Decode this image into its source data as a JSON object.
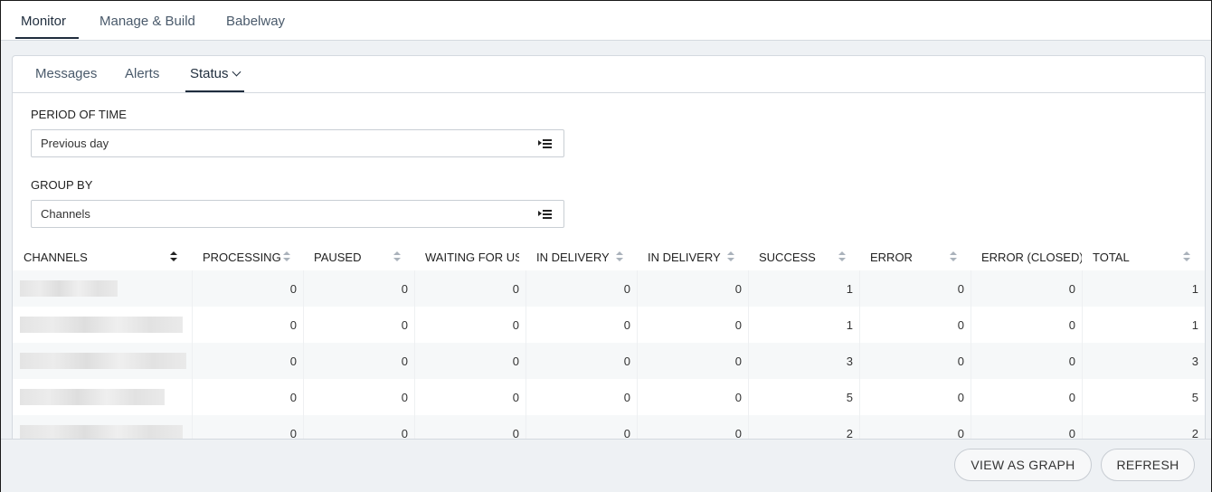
{
  "topnav": {
    "items": [
      {
        "label": "Monitor",
        "active": true
      },
      {
        "label": "Manage & Build",
        "active": false
      },
      {
        "label": "Babelway",
        "active": false
      }
    ]
  },
  "subtabs": {
    "items": [
      {
        "label": "Messages"
      },
      {
        "label": "Alerts"
      },
      {
        "label": "Status"
      }
    ]
  },
  "filters": {
    "period_label": "PERIOD OF TIME",
    "period_value": "Previous day",
    "group_label": "GROUP BY",
    "group_value": "Channels"
  },
  "table": {
    "columns": [
      "CHANNELS",
      "PROCESSING",
      "PAUSED",
      "WAITING FOR USE",
      "IN DELIVERY",
      "IN DELIVERY",
      "SUCCESS",
      "ERROR",
      "ERROR (CLOSED)",
      "TOTAL"
    ],
    "rows": [
      [
        "",
        "0",
        "0",
        "0",
        "0",
        "0",
        "1",
        "0",
        "0",
        "1"
      ],
      [
        "",
        "0",
        "0",
        "0",
        "0",
        "0",
        "1",
        "0",
        "0",
        "1"
      ],
      [
        "",
        "0",
        "0",
        "0",
        "0",
        "0",
        "3",
        "0",
        "0",
        "3"
      ],
      [
        "",
        "0",
        "0",
        "0",
        "0",
        "0",
        "5",
        "0",
        "0",
        "5"
      ],
      [
        "",
        "0",
        "0",
        "0",
        "0",
        "0",
        "2",
        "0",
        "0",
        "2"
      ]
    ]
  },
  "buttons": {
    "graph": "VIEW AS GRAPH",
    "refresh": "REFRESH"
  },
  "colors": {
    "accent": "#1f2d3d",
    "background": "#eef1f4",
    "alt_row": "#f6f8f9"
  },
  "icons": {
    "select": "list-select-icon",
    "sort": "sort-arrows-icon",
    "status_dropdown": "chevron-down-icon"
  }
}
